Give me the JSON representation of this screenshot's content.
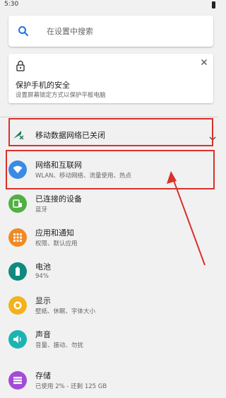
{
  "status": {
    "time": "5:30"
  },
  "search": {
    "placeholder": "在设置中搜索"
  },
  "suggestion": {
    "title": "保护手机的安全",
    "subtitle": "设置屏幕锁定方式以保护平板电脑"
  },
  "condition": {
    "label": "移动数据网络已关闭"
  },
  "items": [
    {
      "title": "网络和互联网",
      "summary": "WLAN、移动网络、流量使用、热点",
      "color": "#3b8be5",
      "icon": "wifi-icon"
    },
    {
      "title": "已连接的设备",
      "summary": "蓝牙",
      "color": "#52b043",
      "icon": "devices-icon"
    },
    {
      "title": "应用和通知",
      "summary": "权限、默认应用",
      "color": "#f08a24",
      "icon": "apps-icon"
    },
    {
      "title": "电池",
      "summary": "94%",
      "color": "#0e8a7f",
      "icon": "battery-icon"
    },
    {
      "title": "显示",
      "summary": "壁纸、休眠、字体大小",
      "color": "#f2b21a",
      "icon": "brightness-icon"
    },
    {
      "title": "声音",
      "summary": "音量、振动、勿扰",
      "color": "#1ab4b1",
      "icon": "volume-icon"
    },
    {
      "title": "存储",
      "summary": "已使用 2% - 还剩 125 GB",
      "color": "#a34bd6",
      "icon": "storage-icon"
    }
  ],
  "colors": {
    "accent": "#1a73e8",
    "highlight": "#d9312b"
  }
}
